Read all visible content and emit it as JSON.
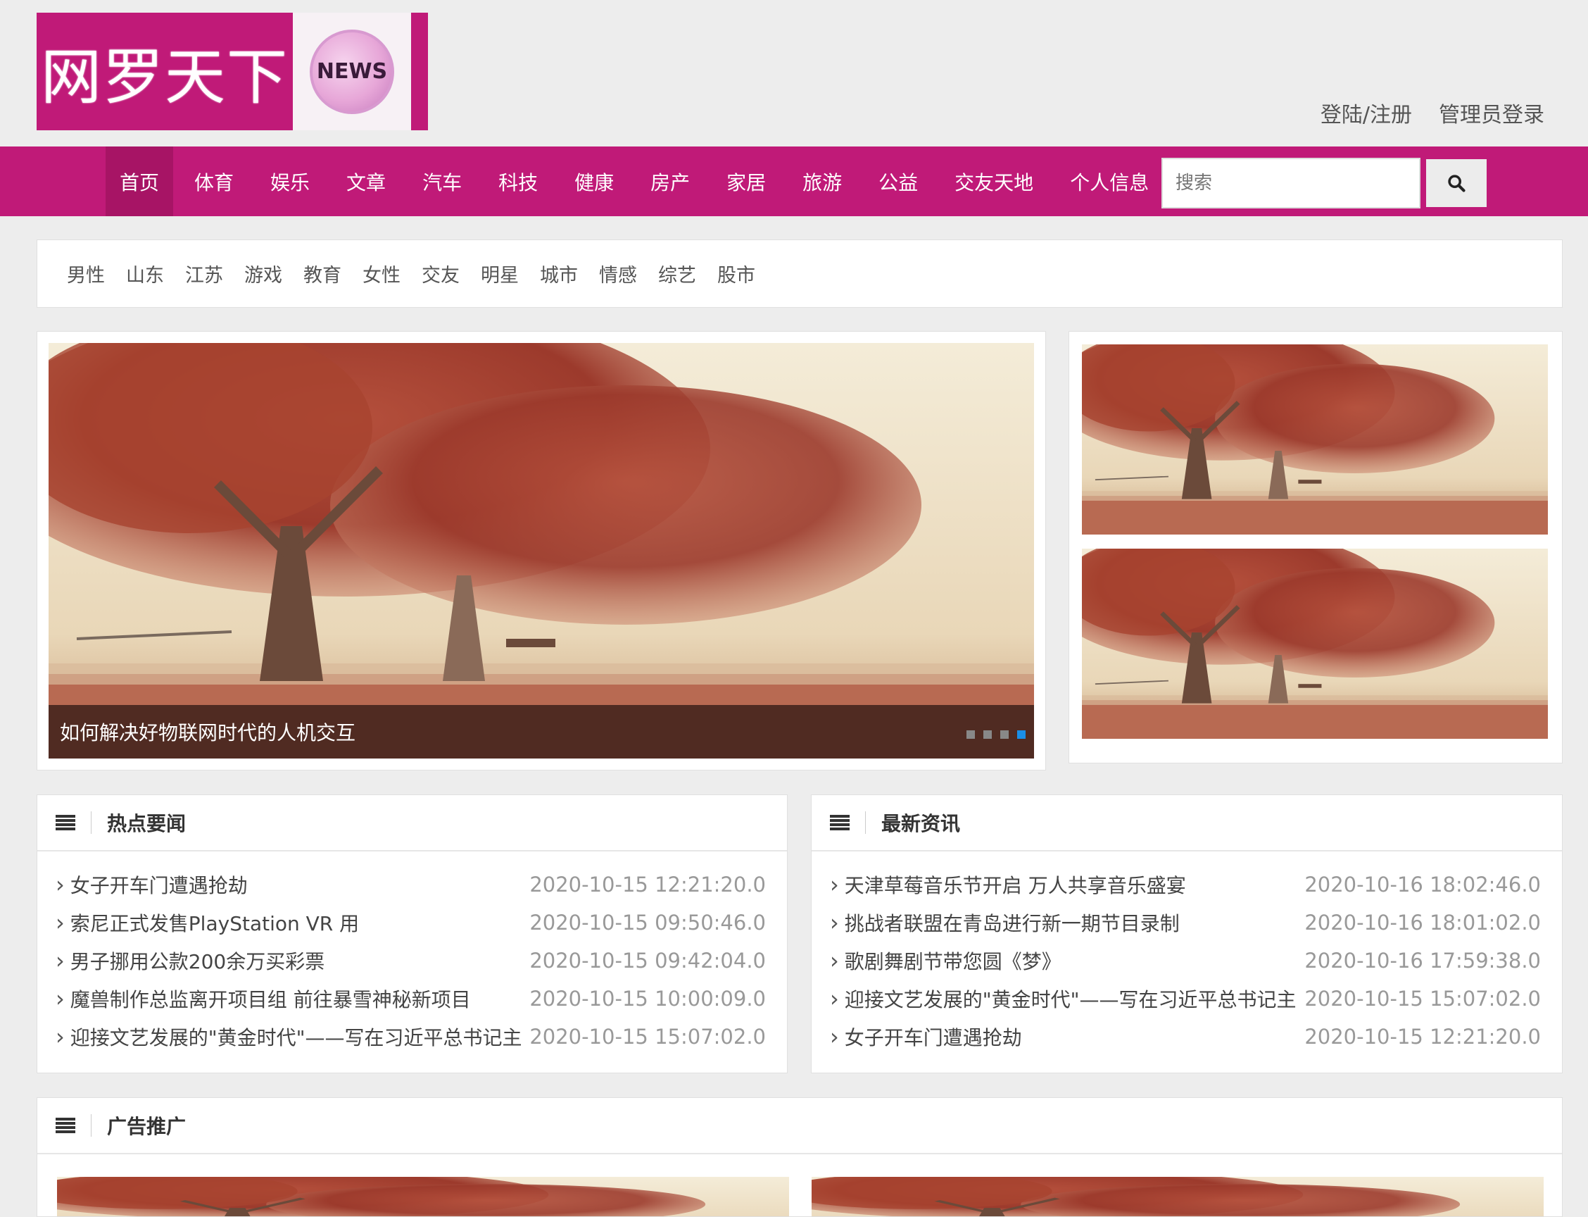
{
  "logo": {
    "text": "网罗天下",
    "badge": "NEWS"
  },
  "top_links": {
    "login": "登陆/注册",
    "admin": "管理员登录"
  },
  "nav": {
    "items": [
      "首页",
      "体育",
      "娱乐",
      "文章",
      "汽车",
      "科技",
      "健康",
      "房产",
      "家居",
      "旅游",
      "公益",
      "交友天地",
      "个人信息"
    ],
    "active": "首页"
  },
  "search": {
    "placeholder": "搜索"
  },
  "tags": [
    "男性",
    "山东",
    "江苏",
    "游戏",
    "教育",
    "女性",
    "交友",
    "明星",
    "城市",
    "情感",
    "综艺",
    "股市"
  ],
  "slider": {
    "caption": "如何解决好物联网时代的人机交互",
    "dot_count": 4,
    "active_dot": 4
  },
  "hot_news": {
    "title": "热点要闻",
    "items": [
      {
        "title": "女子开车门遭遇抢劫",
        "date": "2020-10-15 12:21:20.0"
      },
      {
        "title": "索尼正式发售PlayStation VR 用",
        "date": "2020-10-15 09:50:46.0"
      },
      {
        "title": "男子挪用公款200余万买彩票",
        "date": "2020-10-15 09:42:04.0"
      },
      {
        "title": "魔兽制作总监离开项目组 前往暴雪神秘新项目",
        "date": "2020-10-15 10:00:09.0"
      },
      {
        "title": "迎接文艺发展的\"黄金时代\"——写在习近平总书记主",
        "date": "2020-10-15 15:07:02.0"
      }
    ]
  },
  "latest_news": {
    "title": "最新资讯",
    "items": [
      {
        "title": "天津草莓音乐节开启 万人共享音乐盛宴",
        "date": "2020-10-16 18:02:46.0"
      },
      {
        "title": "挑战者联盟在青岛进行新一期节目录制",
        "date": "2020-10-16 18:01:02.0"
      },
      {
        "title": "歌剧舞剧节带您圆《梦》",
        "date": "2020-10-16 17:59:38.0"
      },
      {
        "title": "迎接文艺发展的\"黄金时代\"——写在习近平总书记主",
        "date": "2020-10-15 15:07:02.0"
      },
      {
        "title": "女子开车门遭遇抢劫",
        "date": "2020-10-15 12:21:20.0"
      }
    ]
  },
  "ads": {
    "title": "广告推广"
  },
  "colors": {
    "brand": "#c01a78",
    "nav_active": "#a71465",
    "dot_active": "#1a8fe8"
  }
}
